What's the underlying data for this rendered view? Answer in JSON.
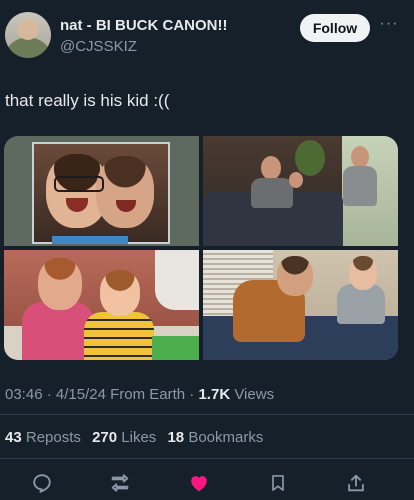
{
  "author": {
    "display_name": "nat - BI BUCK CANON!!",
    "handle": "@CJSSKIZ"
  },
  "follow_label": "Follow",
  "more_label": "···",
  "tweet_text": "that really is his kid :((",
  "media": [
    {
      "name": "photo-1"
    },
    {
      "name": "photo-2"
    },
    {
      "name": "photo-3"
    },
    {
      "name": "photo-4"
    }
  ],
  "meta": {
    "time": "03:46",
    "date": "4/15/24",
    "source": "From Earth",
    "views_count": "1.7K",
    "views_label": "Views"
  },
  "stats": {
    "reposts_count": "43",
    "reposts_label": "Reposts",
    "likes_count": "270",
    "likes_label": "Likes",
    "bookmarks_count": "18",
    "bookmarks_label": "Bookmarks"
  },
  "actions": [
    {
      "icon": "reply-icon"
    },
    {
      "icon": "repost-icon"
    },
    {
      "icon": "like-icon",
      "color": "#f91880"
    },
    {
      "icon": "bookmark-icon"
    },
    {
      "icon": "share-icon"
    }
  ],
  "colors": {
    "background": "#15202b",
    "secondary_text": "#8b98a5",
    "like_active": "#f91880"
  }
}
